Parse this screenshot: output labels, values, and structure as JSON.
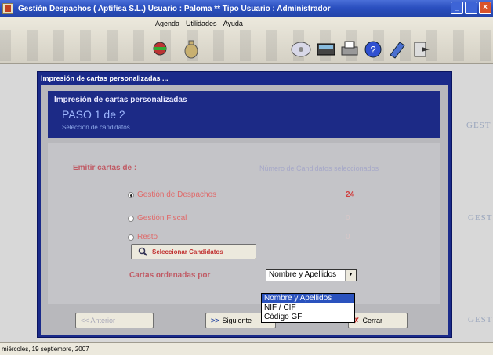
{
  "window": {
    "title": "Gestión Despachos   ( Aptifisa S.L.)   Usuario : Paloma  **  Tipo Usuario : Administrador"
  },
  "menu": [
    "Agenda",
    "Utilidades",
    "Ayuda"
  ],
  "toolbar_icons": [
    "tools-icon",
    "money-bag-icon",
    "cd-icon",
    "calculator-icon",
    "printer-icon",
    "help-icon",
    "notebook-icon",
    "exit-icon"
  ],
  "desktop_watermark": "GEST",
  "status": {
    "date": "miércoles, 19 septiembre, 2007"
  },
  "dialog": {
    "title": "Impresión de cartas personalizadas ...",
    "banner": {
      "title": "Impresión de cartas personalizadas",
      "step": "PASO 1 de 2",
      "subtitle": "Selección de candidatos"
    },
    "emit_label": "Emitir cartas de :",
    "count_label": "Número de Candidatos seleccionados",
    "options": [
      {
        "label": "Gestión de Despachos",
        "checked": true,
        "count": "24"
      },
      {
        "label": "Gestión Fiscal",
        "checked": false,
        "count": "0"
      },
      {
        "label": "Resto",
        "checked": false,
        "count": "0"
      }
    ],
    "select_button": "Seleccionar Candidatos",
    "order_label": "Cartas ordenadas por",
    "order_value": "Nombre y Apellidos",
    "order_options": [
      "Nombre y Apellidos",
      "NIF / CIF",
      "Código GF"
    ],
    "buttons": {
      "prev": "<< Anterior",
      "next": "Siguiente",
      "close": "Cerrar"
    }
  },
  "colors": {
    "titlebar": "#2a4fbf",
    "dialog_frame": "#1a2a8a",
    "accent_red": "#c05a64",
    "selection": "#2a52be"
  }
}
